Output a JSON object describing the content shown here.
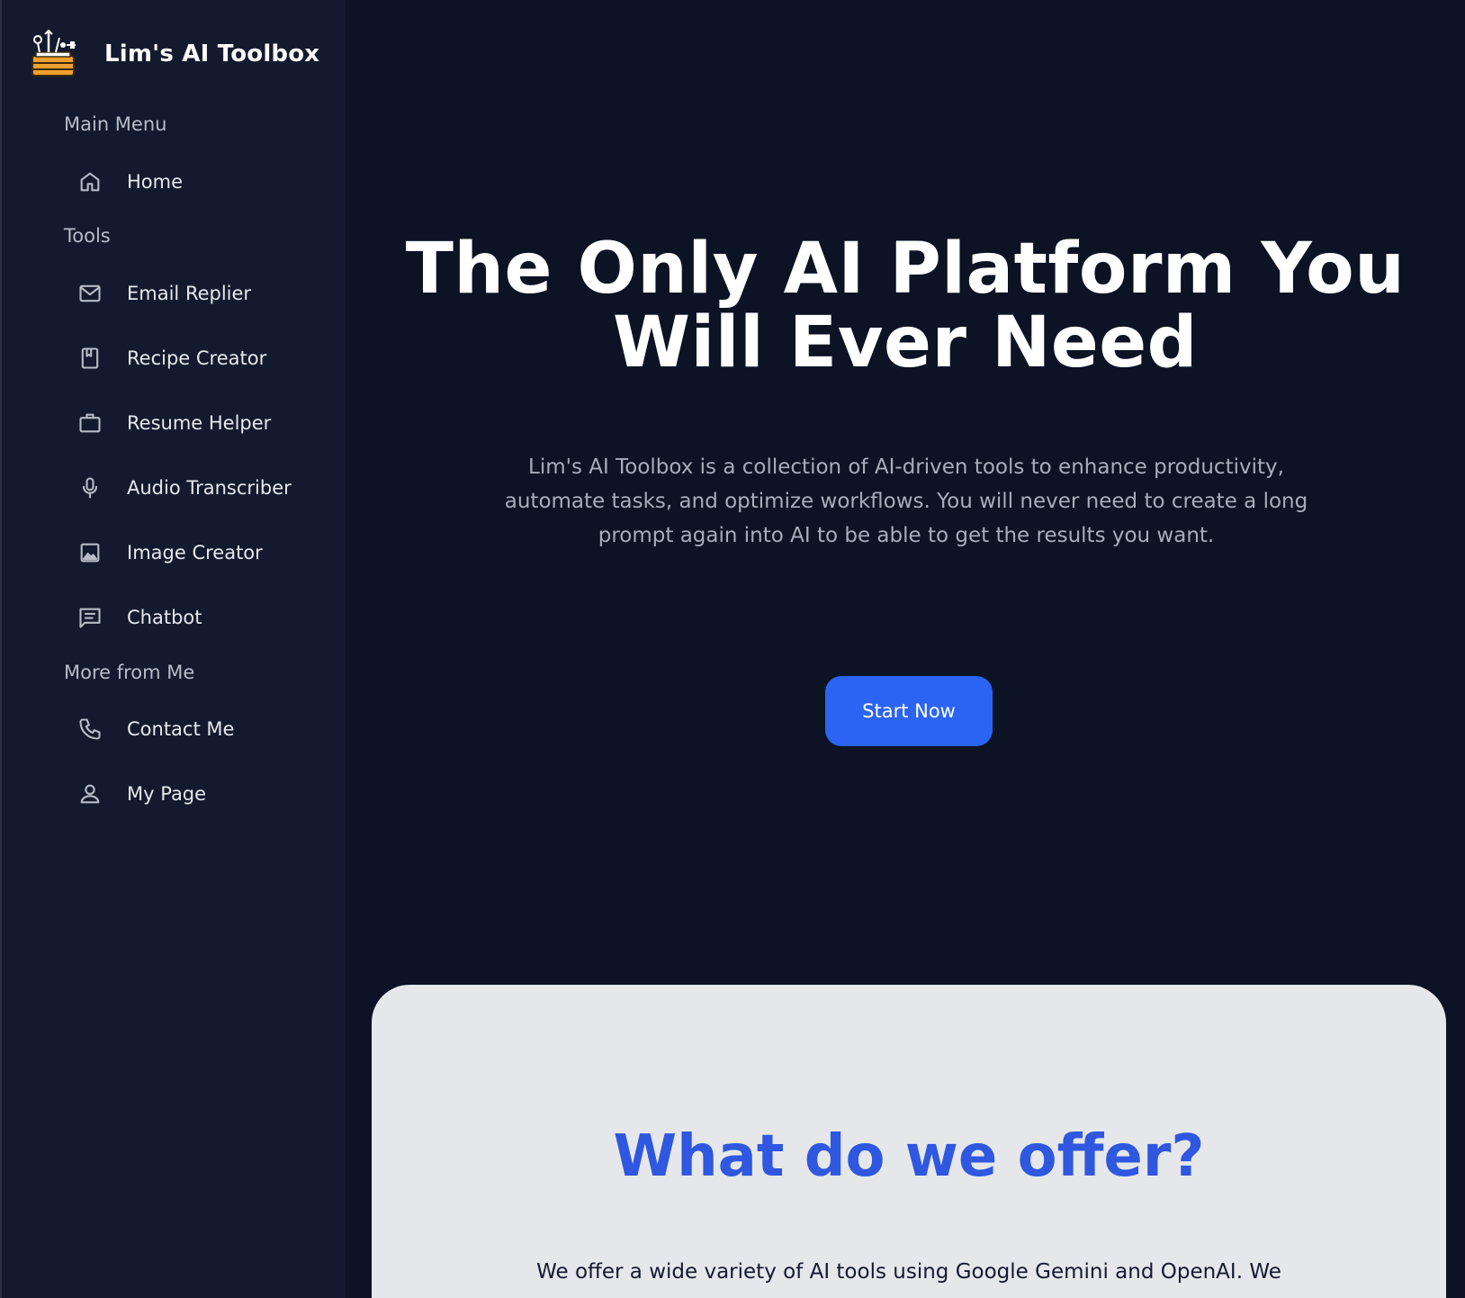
{
  "sidebar": {
    "brand_title": "Lim's AI Toolbox",
    "sections": {
      "main_menu": "Main Menu",
      "tools": "Tools",
      "more": "More from Me"
    },
    "items": {
      "home": "Home",
      "email_replier": "Email Replier",
      "recipe_creator": "Recipe Creator",
      "resume_helper": "Resume Helper",
      "audio_transcriber": "Audio Transcriber",
      "image_creator": "Image Creator",
      "chatbot": "Chatbot",
      "contact_me": "Contact Me",
      "my_page": "My Page"
    },
    "icons": {
      "logo": "toolbox-logo-icon",
      "home": "home-icon",
      "email_replier": "mail-icon",
      "recipe_creator": "book-icon",
      "resume_helper": "briefcase-icon",
      "audio_transcriber": "microphone-icon",
      "image_creator": "image-icon",
      "chatbot": "chat-icon",
      "contact_me": "phone-icon",
      "my_page": "user-icon"
    }
  },
  "hero": {
    "title_line1": "The Only AI Platform You",
    "title_line2": "Will Ever Need",
    "description": "Lim's AI Toolbox is a collection of AI-driven tools to enhance productivity, automate tasks, and optimize workflows. You will never need to create a long prompt again into AI to be able to get the results you want.",
    "cta_label": "Start Now"
  },
  "offer": {
    "title": "What do we offer?",
    "text": "We offer a wide variety of AI tools using Google Gemini and OpenAI. We"
  },
  "colors": {
    "background": "#0b1324",
    "sidebar": "#141a2e",
    "accent": "#2b64f2",
    "offer_title": "#2f57e0",
    "logo_orange": "#f0a030"
  }
}
